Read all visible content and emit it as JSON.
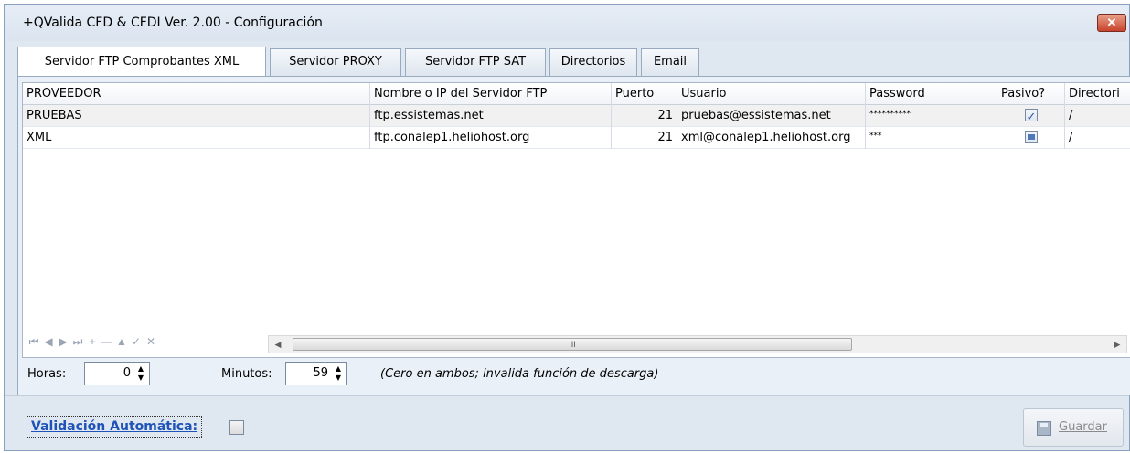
{
  "window": {
    "title": "+QValida CFD & CFDI Ver. 2.00 - Configuración",
    "close_label": "✕"
  },
  "tabs": [
    {
      "label": "Servidor  FTP Comprobantes XML"
    },
    {
      "label": "Servidor PROXY"
    },
    {
      "label": "Servidor FTP SAT"
    },
    {
      "label": "Directorios"
    },
    {
      "label": "Email"
    }
  ],
  "grid": {
    "columns": [
      "PROVEEDOR",
      "Nombre o IP del Servidor FTP",
      "Puerto",
      "Usuario",
      "Password",
      "Pasivo?",
      "Directori"
    ],
    "rows": [
      {
        "proveedor": "PRUEBAS",
        "servidor": "ftp.essistemas.net",
        "puerto": "21",
        "usuario": "pruebas@essistemas.net",
        "password": "**********",
        "pasivo": "checked",
        "directorio": "/"
      },
      {
        "proveedor": "XML",
        "servidor": "ftp.conalep1.heliohost.org",
        "puerto": "21",
        "usuario": "xml@conalep1.heliohost.org",
        "password": "***",
        "pasivo": "indeterminate",
        "directorio": "/"
      }
    ]
  },
  "navigator": {
    "first": "⏮",
    "prev": "◀",
    "next": "▶",
    "last": "⏭",
    "add": "+",
    "delete": "—",
    "up": "▲",
    "post": "✓",
    "cancel": "✕"
  },
  "scroll": {
    "left": "◀",
    "right": "▶",
    "grip": "III"
  },
  "timer": {
    "hours_label": "Horas:",
    "hours_value": "0",
    "minutes_label": "Minutos:",
    "minutes_value": "59",
    "hint": "(Cero en ambos; invalida función de descarga)"
  },
  "auto_validation": {
    "label": "Validación Automática:",
    "checked": false
  },
  "save_button": {
    "label": "Guardar"
  }
}
